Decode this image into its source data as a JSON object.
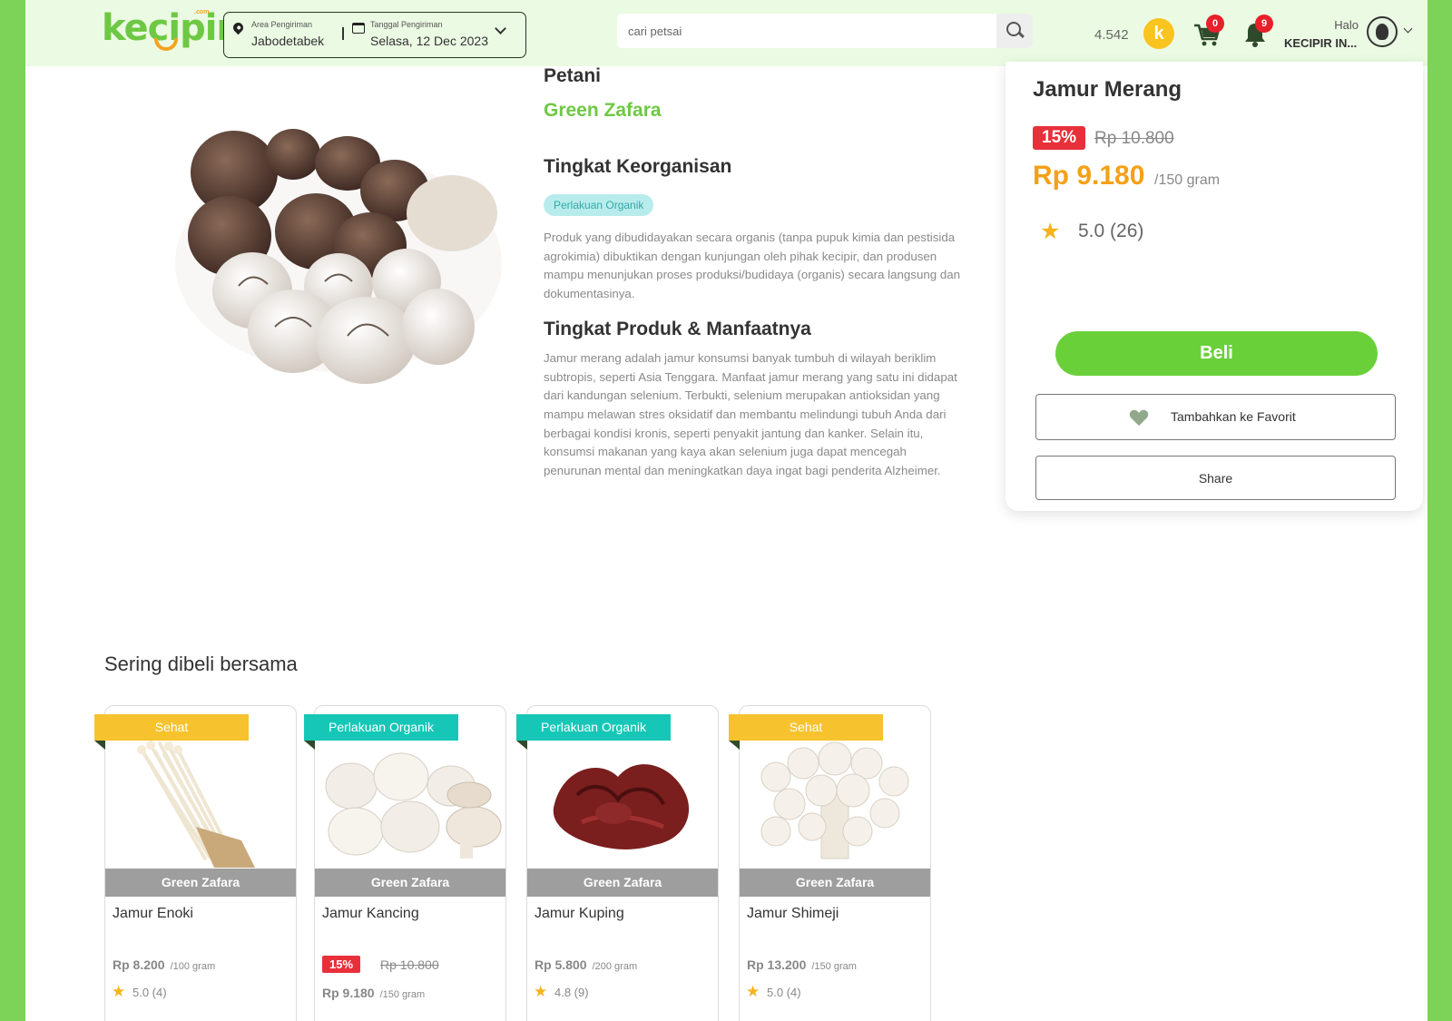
{
  "header": {
    "logo_text": "kecipir",
    "logo_suffix": ".com",
    "area_label": "Area Pengiriman",
    "area_value": "Jabodetabek",
    "date_label": "Tanggal Pengiriman",
    "date_value": "Selasa, 12 Dec 2023",
    "search_placeholder": "cari petsai",
    "points": "4.542",
    "coin_letter": "k",
    "cart_count": "0",
    "notif_count": "9",
    "greeting": "Halo",
    "username": "KECIPIR IN..."
  },
  "product": {
    "farmer_label": "Petani",
    "farmer_name": "Green Zafara",
    "org_title": "Tingkat Keorganisan",
    "org_badge": "Perlakuan Organik",
    "org_desc": "Produk yang dibudidayakan secara organis (tanpa pupuk kimia dan pestisida agrokimia) dibuktikan dengan kunjungan oleh pihak kecipir, dan produsen mampu menunjukan proses produksi/budidaya (organis) secara langsung dan dokumentasinya.",
    "benefit_title": "Tingkat Produk & Manfaatnya",
    "benefit_desc": "Jamur merang adalah jamur konsumsi banyak tumbuh di wilayah beriklim subtropis, seperti Asia Tenggara. Manfaat jamur merang yang satu ini didapat dari kandungan selenium. Terbukti, selenium merupakan antioksidan yang mampu melawan stres oksidatif dan membantu melindungi tubuh Anda dari berbagai kondisi kronis, seperti penyakit jantung dan kanker. Selain itu, konsumsi makanan yang kaya akan selenium juga dapat mencegah penurunan mental dan meningkatkan daya ingat bagi penderita Alzheimer.",
    "name": "Jamur Merang",
    "discount": "15%",
    "old_price": "Rp 10.800",
    "price": "Rp 9.180",
    "unit": "/150 gram",
    "rating": "5.0 (26)",
    "buy_label": "Beli",
    "fav_label": "Tambahkan ke Favorit",
    "share_label": "Share"
  },
  "related": {
    "title": "Sering dibeli bersama",
    "items": [
      {
        "tag": "Sehat",
        "farmer": "Green Zafara",
        "name": "Jamur Enoki",
        "price": "Rp 8.200",
        "unit": "/100 gram",
        "rating": "5.0 (4)"
      },
      {
        "tag": "Perlakuan Organik",
        "farmer": "Green Zafara",
        "name": "Jamur Kancing",
        "discount": "15%",
        "old_price": "Rp 10.800",
        "price": "Rp 9.180",
        "unit": "/150 gram"
      },
      {
        "tag": "Perlakuan Organik",
        "farmer": "Green Zafara",
        "name": "Jamur Kuping",
        "price": "Rp 5.800",
        "unit": "/200 gram",
        "rating": "4.8 (9)"
      },
      {
        "tag": "Sehat",
        "farmer": "Green Zafara",
        "name": "Jamur Shimeji",
        "price": "Rp 13.200",
        "unit": "/150 gram",
        "rating": "5.0 (4)"
      }
    ]
  },
  "colors": {
    "brand_green": "#6ec843",
    "accent_orange": "#f5a116",
    "discount_red": "#e8303a",
    "tag_sehat": "#f6c22e",
    "tag_organik": "#16c7b7"
  }
}
